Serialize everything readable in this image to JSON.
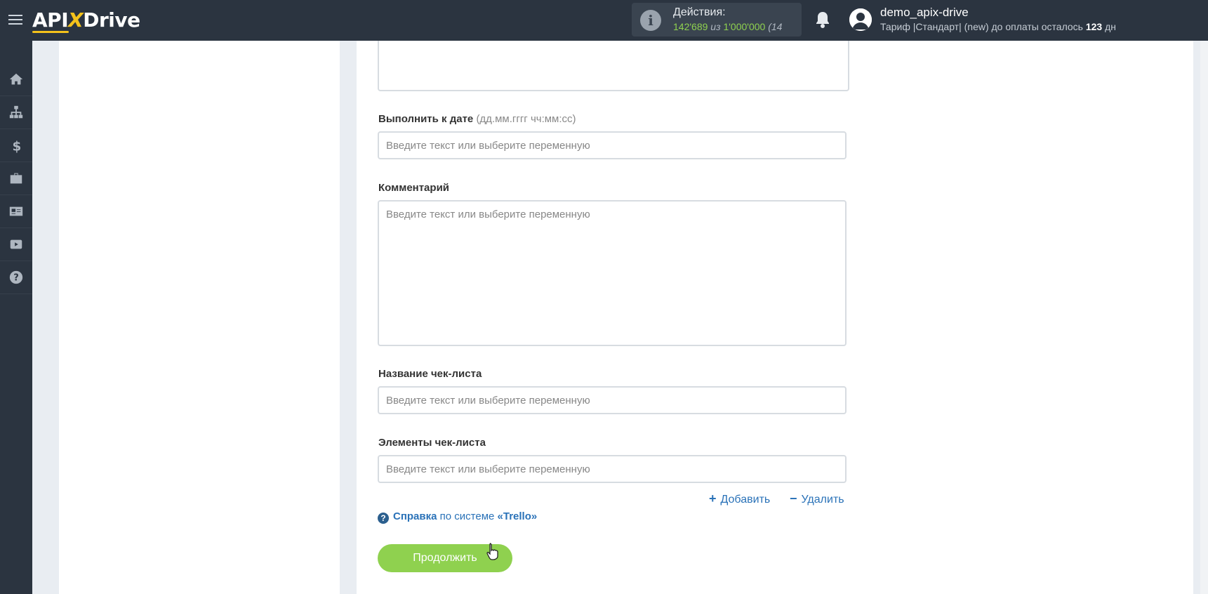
{
  "header": {
    "logo_text_a": "API",
    "logo_text_x": "X",
    "logo_text_b": "Drive",
    "actions": {
      "label": "Действия:",
      "used": "142'689",
      "separator": "из",
      "total": "1'000'000",
      "extra": "(14"
    },
    "user": {
      "name": "demo_apix-drive",
      "plan_text": "Тариф |Стандарт| (new) до оплаты осталось",
      "days": "123",
      "days_unit": "дн"
    }
  },
  "sidebar": {
    "items": [
      {
        "icon": "home-icon"
      },
      {
        "icon": "sitemap-icon"
      },
      {
        "icon": "dollar-icon"
      },
      {
        "icon": "briefcase-icon"
      },
      {
        "icon": "id-card-icon"
      },
      {
        "icon": "youtube-icon"
      },
      {
        "icon": "help-icon"
      }
    ]
  },
  "form": {
    "due_date": {
      "label": "Выполнить к дате",
      "hint": "(дд.мм.гггг чч:мм:сс)",
      "placeholder": "Введите текст или выберите переменную"
    },
    "comment": {
      "label": "Комментарий",
      "placeholder": "Введите текст или выберите переменную"
    },
    "checklist_name": {
      "label": "Название чек-листа",
      "placeholder": "Введите текст или выберите переменную"
    },
    "checklist_items": {
      "label": "Элементы чек-листа",
      "placeholder": "Введите текст или выберите переменную"
    },
    "add_label": "Добавить",
    "remove_label": "Удалить",
    "help": {
      "link": "Справка",
      "middle": "по системе",
      "system": "«Trello»"
    },
    "continue_label": "Продолжить"
  },
  "colors": {
    "topbar": "#2b3440",
    "accent_green": "#8fd14f",
    "link_blue": "#2a72b8",
    "logo_yellow": "#f4c21b"
  }
}
